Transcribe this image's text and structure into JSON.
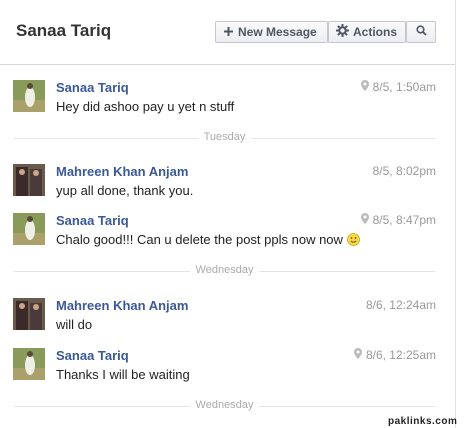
{
  "header": {
    "title": "Sanaa Tariq",
    "new_message_label": "New Message",
    "actions_label": "Actions"
  },
  "messages": [
    {
      "sender": "Sanaa Tariq",
      "time": "8/5, 1:50am",
      "text": "Hey did ashoo pay u yet n stuff",
      "has_location": true
    },
    {
      "sender": "Mahreen Khan Anjam",
      "time": "8/5, 8:02pm",
      "text": "yup all done, thank you.",
      "has_location": false
    },
    {
      "sender": "Sanaa Tariq",
      "time": "8/5, 8:47pm",
      "text": "Chalo good!!! Can u delete the post ppls now now",
      "has_location": true,
      "emoji": "smiley"
    },
    {
      "sender": "Mahreen Khan Anjam",
      "time": "8/6, 12:24am",
      "text": "will do",
      "has_location": false
    },
    {
      "sender": "Sanaa Tariq",
      "time": "8/6, 12:25am",
      "text": "Thanks I will be waiting",
      "has_location": true
    }
  ],
  "dividers": [
    "Tuesday",
    "Wednesday",
    "Wednesday"
  ],
  "watermark": "paklinks.com",
  "colors": {
    "sender_name": "#3b5998",
    "timestamp": "#999999",
    "divider_line": "#e5e5e5"
  },
  "icons": {
    "new_message": "plus-icon",
    "actions": "gear-icon",
    "search": "search-icon",
    "location": "location-pin-icon",
    "emoji": "smiley-icon"
  }
}
